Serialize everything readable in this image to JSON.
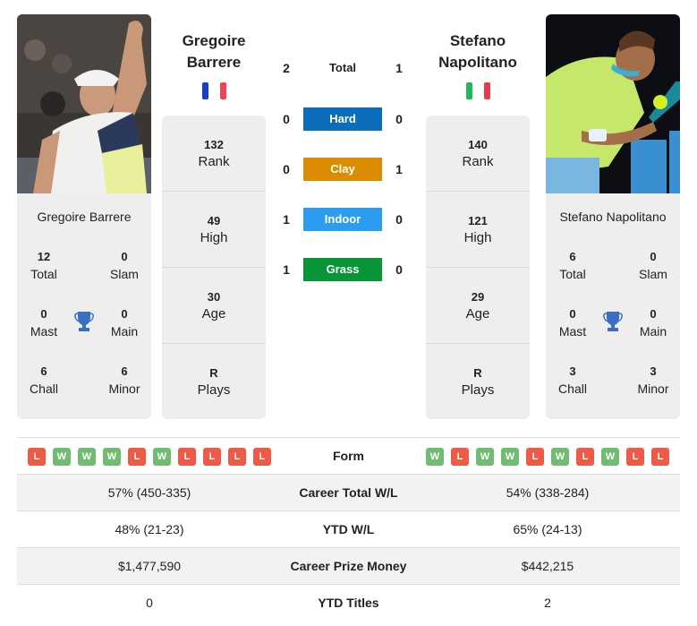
{
  "h2h": {
    "total": {
      "label": "Total",
      "left": "2",
      "right": "1"
    },
    "surfaces": [
      {
        "label": "Hard",
        "left": "0",
        "right": "0",
        "color": "#0a6ebd"
      },
      {
        "label": "Clay",
        "left": "0",
        "right": "1",
        "color": "#dc8c00"
      },
      {
        "label": "Indoor",
        "left": "1",
        "right": "0",
        "color": "#2c9cf0"
      },
      {
        "label": "Grass",
        "left": "1",
        "right": "0",
        "color": "#079538"
      }
    ]
  },
  "players": [
    {
      "name_line1": "Gregoire",
      "name_line2": "Barrere",
      "full_name": "Gregoire Barrere",
      "country": "France",
      "flag_colors": [
        "#1a3fc2",
        "#ffffff",
        "#ef4456"
      ],
      "photo_icon": "player-photo",
      "stats": [
        {
          "value": "132",
          "label": "Rank"
        },
        {
          "value": "49",
          "label": "High"
        },
        {
          "value": "30",
          "label": "Age"
        },
        {
          "value": "R",
          "label": "Plays"
        }
      ],
      "titles": {
        "total": {
          "value": "12",
          "label": "Total"
        },
        "slam": {
          "value": "0",
          "label": "Slam"
        },
        "mast": {
          "value": "0",
          "label": "Mast"
        },
        "main": {
          "value": "0",
          "label": "Main"
        },
        "chall": {
          "value": "6",
          "label": "Chall"
        },
        "minor": {
          "value": "6",
          "label": "Minor"
        }
      },
      "form": [
        "L",
        "W",
        "W",
        "W",
        "L",
        "W",
        "L",
        "L",
        "L",
        "L"
      ]
    },
    {
      "name_line1": "Stefano",
      "name_line2": "Napolitano",
      "full_name": "Stefano Napolitano",
      "country": "Italy",
      "flag_colors": [
        "#1db954",
        "#ffffff",
        "#e8394a"
      ],
      "photo_icon": "player-photo",
      "stats": [
        {
          "value": "140",
          "label": "Rank"
        },
        {
          "value": "121",
          "label": "High"
        },
        {
          "value": "29",
          "label": "Age"
        },
        {
          "value": "R",
          "label": "Plays"
        }
      ],
      "titles": {
        "total": {
          "value": "6",
          "label": "Total"
        },
        "slam": {
          "value": "0",
          "label": "Slam"
        },
        "mast": {
          "value": "0",
          "label": "Mast"
        },
        "main": {
          "value": "0",
          "label": "Main"
        },
        "chall": {
          "value": "3",
          "label": "Chall"
        },
        "minor": {
          "value": "3",
          "label": "Minor"
        }
      },
      "form": [
        "W",
        "L",
        "W",
        "W",
        "L",
        "W",
        "L",
        "W",
        "L",
        "L"
      ]
    }
  ],
  "comparison": {
    "form_label": "Form",
    "rows": [
      {
        "label": "Career Total W/L",
        "left": "57% (450-335)",
        "right": "54% (338-284)"
      },
      {
        "label": "YTD W/L",
        "left": "48% (21-23)",
        "right": "65% (24-13)"
      },
      {
        "label": "Career Prize Money",
        "left": "$1,477,590",
        "right": "$442,215"
      },
      {
        "label": "YTD Titles",
        "left": "0",
        "right": "2"
      }
    ]
  },
  "colors": {
    "trophy": "#3a6fc0",
    "win": "#72bb72",
    "loss": "#ed5a45",
    "card_bg": "#eeeeee"
  }
}
